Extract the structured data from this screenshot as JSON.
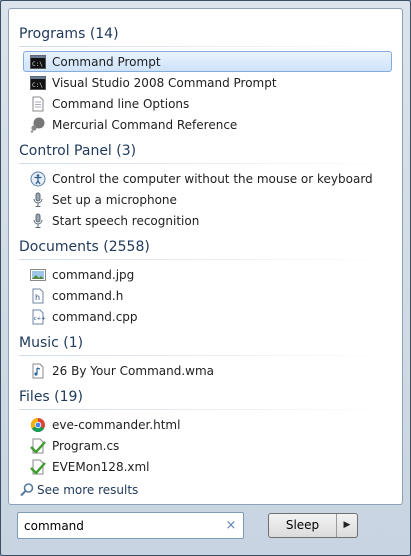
{
  "groups": [
    {
      "title": "Programs (14)",
      "items": [
        {
          "label": "Command Prompt",
          "icon": "command-prompt-icon",
          "selected": true
        },
        {
          "label": "Visual Studio 2008 Command Prompt",
          "icon": "command-prompt-icon"
        },
        {
          "label": "Command line Options",
          "icon": "document-icon"
        },
        {
          "label": "Mercurial Command Reference",
          "icon": "mercurial-icon"
        }
      ]
    },
    {
      "title": "Control Panel (3)",
      "items": [
        {
          "label": "Control the computer without the mouse or keyboard",
          "icon": "ease-of-access-icon"
        },
        {
          "label": "Set up a microphone",
          "icon": "microphone-icon"
        },
        {
          "label": "Start speech recognition",
          "icon": "microphone-icon"
        }
      ]
    },
    {
      "title": "Documents (2558)",
      "items": [
        {
          "label": "command.jpg",
          "icon": "image-file-icon"
        },
        {
          "label": "command.h",
          "icon": "header-file-icon"
        },
        {
          "label": "command.cpp",
          "icon": "cpp-file-icon"
        }
      ]
    },
    {
      "title": "Music (1)",
      "items": [
        {
          "label": "26 By Your Command.wma",
          "icon": "music-file-icon"
        }
      ]
    },
    {
      "title": "Files (19)",
      "items": [
        {
          "label": "eve-commander.html",
          "icon": "chrome-icon"
        },
        {
          "label": "Program.cs",
          "icon": "cs-file-icon"
        },
        {
          "label": "EVEMon128.xml",
          "icon": "xml-file-icon"
        }
      ]
    }
  ],
  "see_more_label": "See more results",
  "search": {
    "value": "command",
    "clear_icon": "×"
  },
  "sleep": {
    "label": "Sleep",
    "arrow": "▶"
  },
  "colors": {
    "header": "#1e395b",
    "selected_bg": "#cfe3fa",
    "selected_border": "#84acdd"
  }
}
